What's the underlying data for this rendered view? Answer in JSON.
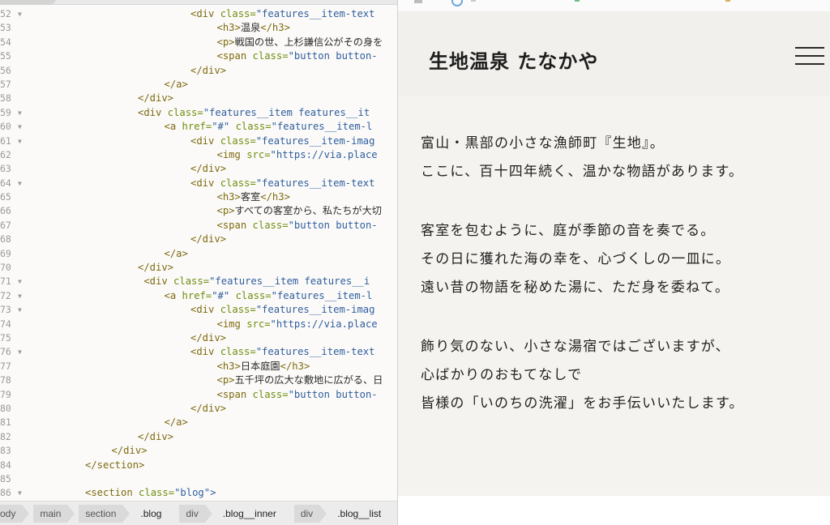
{
  "editor": {
    "lines": [
      {
        "n": "52",
        "fold": true,
        "indent": 6,
        "tokens": [
          [
            "tag",
            "<div "
          ],
          [
            "attr",
            "class="
          ],
          [
            "str",
            "\"features__item-text"
          ]
        ]
      },
      {
        "n": "53",
        "fold": false,
        "indent": 7,
        "tokens": [
          [
            "tag",
            "<h3>"
          ],
          [
            "text",
            "温泉"
          ],
          [
            "tag",
            "</h3>"
          ]
        ]
      },
      {
        "n": "54",
        "fold": false,
        "indent": 7,
        "tokens": [
          [
            "tag",
            "<p>"
          ],
          [
            "text",
            "戦国の世、上杉謙信公がその身を"
          ]
        ]
      },
      {
        "n": "55",
        "fold": false,
        "indent": 7,
        "tokens": [
          [
            "tag",
            "<span "
          ],
          [
            "attr",
            "class="
          ],
          [
            "str",
            "\"button button-"
          ]
        ]
      },
      {
        "n": "56",
        "fold": false,
        "indent": 6,
        "tokens": [
          [
            "tag",
            "</div>"
          ]
        ]
      },
      {
        "n": "57",
        "fold": false,
        "indent": 5,
        "tokens": [
          [
            "tag",
            "</a>"
          ]
        ]
      },
      {
        "n": "58",
        "fold": false,
        "indent": 4,
        "tokens": [
          [
            "tag",
            "</div>"
          ]
        ]
      },
      {
        "n": "59",
        "fold": true,
        "indent": 4,
        "tokens": [
          [
            "tag",
            "<div "
          ],
          [
            "attr",
            "class="
          ],
          [
            "str",
            "\"features__item features__it"
          ]
        ]
      },
      {
        "n": "60",
        "fold": true,
        "indent": 5,
        "tokens": [
          [
            "tag",
            "<a "
          ],
          [
            "attr",
            "href="
          ],
          [
            "str",
            "\"#\" "
          ],
          [
            "attr",
            "class="
          ],
          [
            "str",
            "\"features__item-l"
          ]
        ]
      },
      {
        "n": "61",
        "fold": true,
        "indent": 6,
        "tokens": [
          [
            "tag",
            "<div "
          ],
          [
            "attr",
            "class="
          ],
          [
            "str",
            "\"features__item-imag"
          ]
        ]
      },
      {
        "n": "62",
        "fold": false,
        "indent": 7,
        "tokens": [
          [
            "tag",
            "<img "
          ],
          [
            "attr",
            "src="
          ],
          [
            "str",
            "\"https://via.place"
          ]
        ]
      },
      {
        "n": "63",
        "fold": false,
        "indent": 6,
        "tokens": [
          [
            "tag",
            "</div>"
          ]
        ]
      },
      {
        "n": "64",
        "fold": true,
        "indent": 6,
        "tokens": [
          [
            "tag",
            "<div "
          ],
          [
            "attr",
            "class="
          ],
          [
            "str",
            "\"features__item-text"
          ]
        ]
      },
      {
        "n": "65",
        "fold": false,
        "indent": 7,
        "tokens": [
          [
            "tag",
            "<h3>"
          ],
          [
            "text",
            "客室"
          ],
          [
            "tag",
            "</h3>"
          ]
        ]
      },
      {
        "n": "66",
        "fold": false,
        "indent": 7,
        "tokens": [
          [
            "tag",
            "<p>"
          ],
          [
            "text",
            "すべての客室から、私たちが大切"
          ]
        ]
      },
      {
        "n": "67",
        "fold": false,
        "indent": 7,
        "tokens": [
          [
            "tag",
            "<span "
          ],
          [
            "attr",
            "class="
          ],
          [
            "str",
            "\"button button-"
          ]
        ]
      },
      {
        "n": "68",
        "fold": false,
        "indent": 6,
        "tokens": [
          [
            "tag",
            "</div>"
          ]
        ]
      },
      {
        "n": "69",
        "fold": false,
        "indent": 5,
        "tokens": [
          [
            "tag",
            "</a>"
          ]
        ]
      },
      {
        "n": "70",
        "fold": false,
        "indent": 4,
        "tokens": [
          [
            "tag",
            "</div>"
          ]
        ]
      },
      {
        "n": "71",
        "fold": true,
        "indent": 4,
        "tokens": [
          [
            "text",
            " "
          ],
          [
            "tag",
            "<div "
          ],
          [
            "attr",
            "class="
          ],
          [
            "str",
            "\"features__item features__i"
          ]
        ]
      },
      {
        "n": "72",
        "fold": true,
        "indent": 5,
        "tokens": [
          [
            "tag",
            "<a "
          ],
          [
            "attr",
            "href="
          ],
          [
            "str",
            "\"#\" "
          ],
          [
            "attr",
            "class="
          ],
          [
            "str",
            "\"features__item-l"
          ]
        ]
      },
      {
        "n": "73",
        "fold": true,
        "indent": 6,
        "tokens": [
          [
            "tag",
            "<div "
          ],
          [
            "attr",
            "class="
          ],
          [
            "str",
            "\"features__item-imag"
          ]
        ]
      },
      {
        "n": "74",
        "fold": false,
        "indent": 7,
        "tokens": [
          [
            "tag",
            "<img "
          ],
          [
            "attr",
            "src="
          ],
          [
            "str",
            "\"https://via.place"
          ]
        ]
      },
      {
        "n": "75",
        "fold": false,
        "indent": 6,
        "tokens": [
          [
            "tag",
            "</div>"
          ]
        ]
      },
      {
        "n": "76",
        "fold": true,
        "indent": 6,
        "tokens": [
          [
            "tag",
            "<div "
          ],
          [
            "attr",
            "class="
          ],
          [
            "str",
            "\"features__item-text"
          ]
        ]
      },
      {
        "n": "77",
        "fold": false,
        "indent": 7,
        "tokens": [
          [
            "tag",
            "<h3>"
          ],
          [
            "text",
            "日本庭園"
          ],
          [
            "tag",
            "</h3>"
          ]
        ]
      },
      {
        "n": "78",
        "fold": false,
        "indent": 7,
        "tokens": [
          [
            "tag",
            "<p>"
          ],
          [
            "text",
            "五千坪の広大な敷地に広がる、日"
          ]
        ]
      },
      {
        "n": "79",
        "fold": false,
        "indent": 7,
        "tokens": [
          [
            "tag",
            "<span "
          ],
          [
            "attr",
            "class="
          ],
          [
            "str",
            "\"button button-"
          ]
        ]
      },
      {
        "n": "80",
        "fold": false,
        "indent": 6,
        "tokens": [
          [
            "tag",
            "</div>"
          ]
        ]
      },
      {
        "n": "81",
        "fold": false,
        "indent": 5,
        "tokens": [
          [
            "tag",
            "</a>"
          ]
        ]
      },
      {
        "n": "82",
        "fold": false,
        "indent": 4,
        "tokens": [
          [
            "tag",
            "</div>"
          ]
        ]
      },
      {
        "n": "83",
        "fold": false,
        "indent": 3,
        "tokens": [
          [
            "tag",
            "</div>"
          ]
        ]
      },
      {
        "n": "84",
        "fold": false,
        "indent": 2,
        "tokens": [
          [
            "tag",
            "</section>"
          ]
        ]
      },
      {
        "n": "85",
        "fold": false,
        "indent": 0,
        "tokens": []
      },
      {
        "n": "86",
        "fold": true,
        "indent": 2,
        "tokens": [
          [
            "tag",
            "<section "
          ],
          [
            "attr",
            "class="
          ],
          [
            "str",
            "\"blog\">"
          ]
        ]
      }
    ],
    "breadcrumbs": [
      "ody",
      "main",
      "section",
      ".blog",
      "div",
      ".blog__inner",
      "div",
      ".blog__list"
    ]
  },
  "preview": {
    "site_title": "生地温泉 たなかや",
    "menu_icon": "hamburger-menu-icon",
    "intro_paragraphs": [
      [
        "富山・黒部の小さな漁師町『生地』。",
        "ここに、百十四年続く、温かな物語があります。"
      ],
      [
        "客室を包むように、庭が季節の音を奏でる。",
        "その日に獲れた海の幸を、心づくしの一皿に。",
        "遠い昔の物語を秘めた湯に、ただ身を委ねて。"
      ],
      [
        "飾り気のない、小さな湯宿ではございますが、",
        "心ばかりのおもてなしで",
        "皆様の「いのちの洗濯」をお手伝いいたします。"
      ]
    ]
  }
}
